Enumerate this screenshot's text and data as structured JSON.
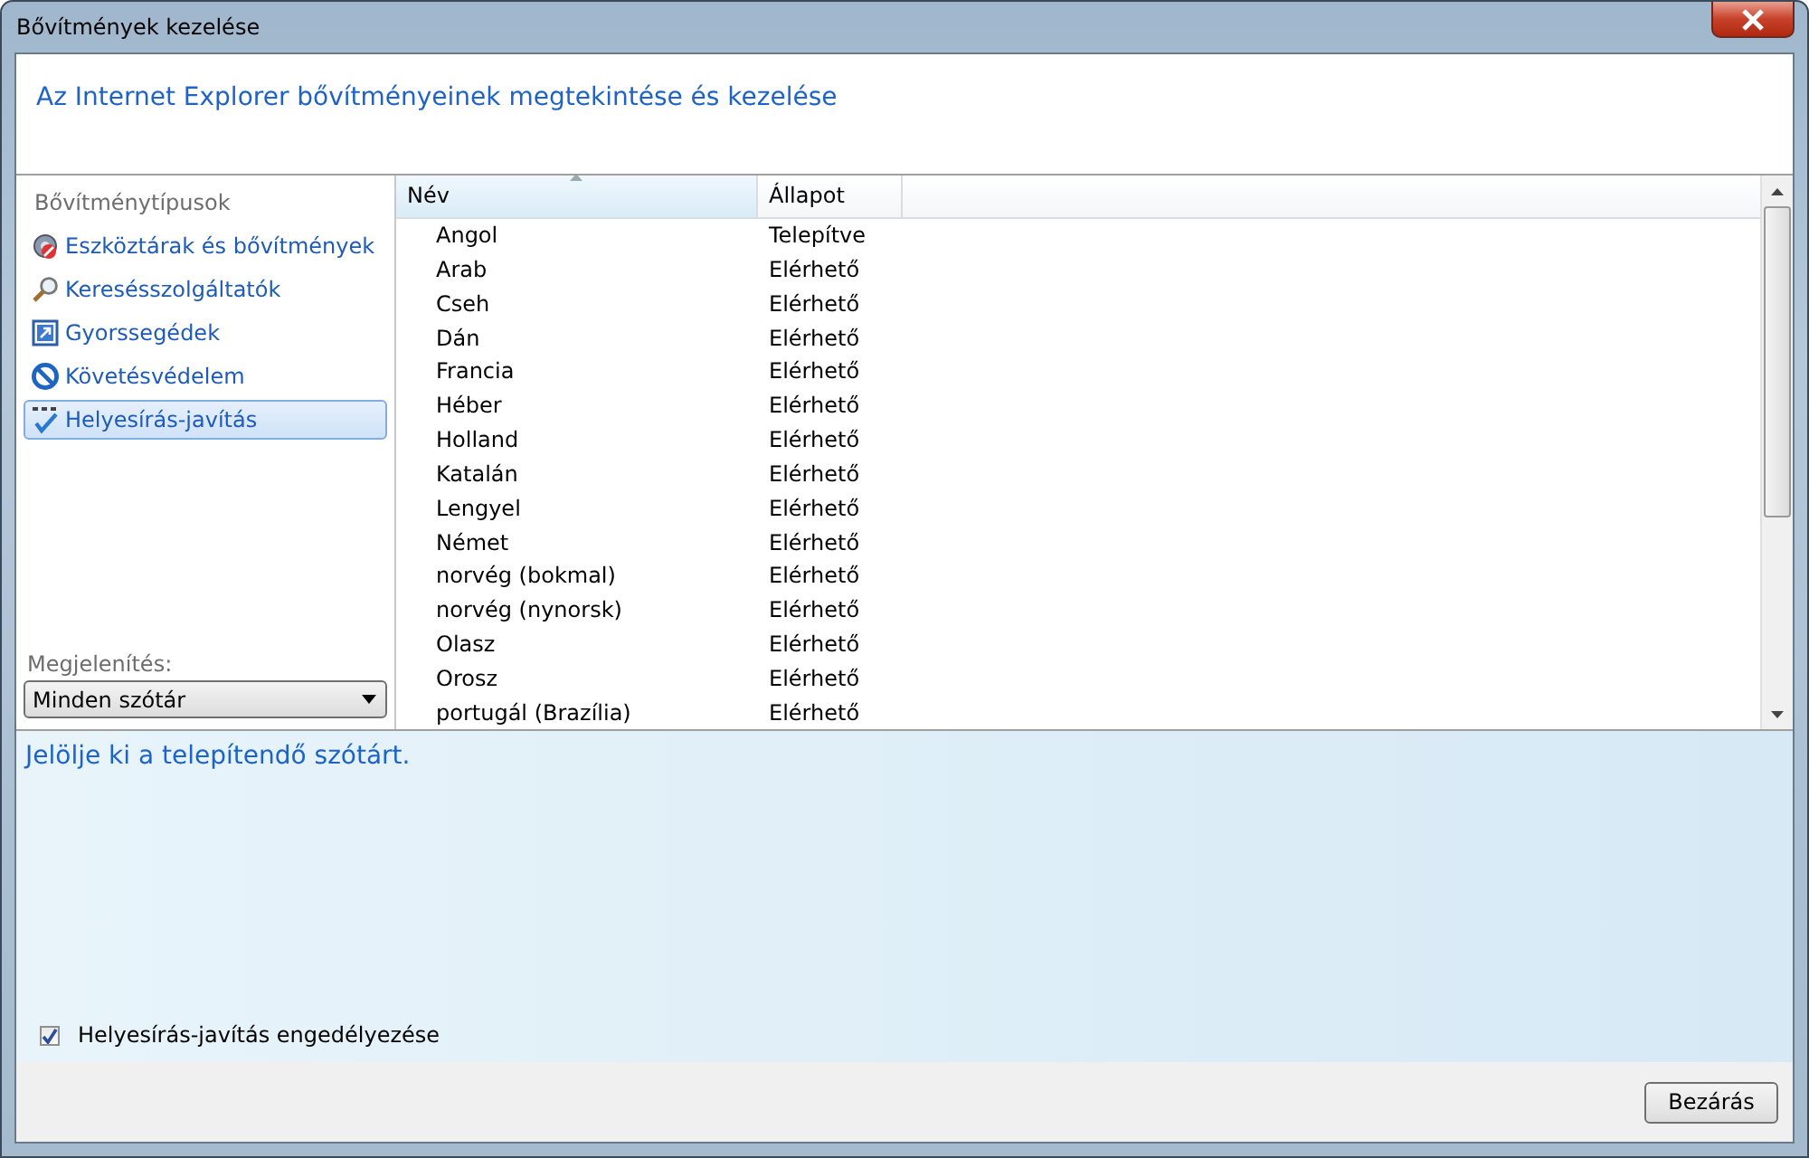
{
  "window": {
    "title": "Bővítmények kezelése"
  },
  "header": {
    "title": "Az Internet Explorer bővítményeinek megtekintése és kezelése"
  },
  "sidebar": {
    "heading": "Bővítménytípusok",
    "items": [
      {
        "label": "Eszköztárak és bővítmények",
        "kind": "toolbars",
        "selected": false
      },
      {
        "label": "Keresésszolgáltatók",
        "kind": "search",
        "selected": false
      },
      {
        "label": "Gyorssegédek",
        "kind": "accelerators",
        "selected": false
      },
      {
        "label": "Követésvédelem",
        "kind": "tracking",
        "selected": false
      },
      {
        "label": "Helyesírás-javítás",
        "kind": "spelling",
        "selected": true
      }
    ],
    "show_label": "Megjelenítés:",
    "show_value": "Minden szótár"
  },
  "table": {
    "columns": [
      "Név",
      "Állapot"
    ],
    "rows": [
      [
        "Angol",
        "Telepítve"
      ],
      [
        "Arab",
        "Elérhető"
      ],
      [
        "Cseh",
        "Elérhető"
      ],
      [
        "Dán",
        "Elérhető"
      ],
      [
        "Francia",
        "Elérhető"
      ],
      [
        "Héber",
        "Elérhető"
      ],
      [
        "Holland",
        "Elérhető"
      ],
      [
        "Katalán",
        "Elérhető"
      ],
      [
        "Lengyel",
        "Elérhető"
      ],
      [
        "Német",
        "Elérhető"
      ],
      [
        "norvég (bokmal)",
        "Elérhető"
      ],
      [
        "norvég (nynorsk)",
        "Elérhető"
      ],
      [
        "Olasz",
        "Elérhető"
      ],
      [
        "Orosz",
        "Elérhető"
      ],
      [
        "portugál (Brazília)",
        "Elérhető"
      ]
    ]
  },
  "details": {
    "message": "Jelölje ki a telepítendő szótárt.",
    "checkbox": {
      "label": "Helyesírás-javítás engedélyezése",
      "checked": true
    }
  },
  "buttons": [
    "Bezárás"
  ]
}
